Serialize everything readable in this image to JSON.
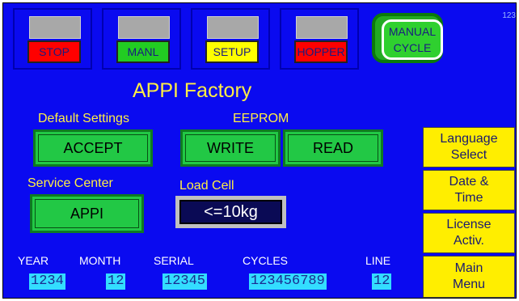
{
  "indicators": [
    {
      "label": "STOP",
      "bg": "#ff0000",
      "fg": "#1a1a80"
    },
    {
      "label": "MANL",
      "bg": "#22cc22",
      "fg": "#1a1a80"
    },
    {
      "label": "SETUP",
      "bg": "#ffff00",
      "fg": "#1a1a80"
    },
    {
      "label": "HOPPER",
      "bg": "#ff0000",
      "fg": "#1a1a80"
    }
  ],
  "manual_cycle": {
    "line1": "MANUAL",
    "line2": "CYCLE"
  },
  "corner_id": "123",
  "title": "APPI Factory",
  "default_settings": {
    "label": "Default Settings",
    "button": "ACCEPT"
  },
  "eeprom": {
    "label": "EEPROM",
    "write": "WRITE",
    "read": "READ"
  },
  "service_center": {
    "label": "Service Center",
    "button": "APPI"
  },
  "load_cell": {
    "label": "Load Cell",
    "value": "<=10kg"
  },
  "side_menu": [
    {
      "line1": "Language",
      "line2": "Select"
    },
    {
      "line1": "Date &",
      "line2": "Time"
    },
    {
      "line1": "License",
      "line2": "Activ."
    },
    {
      "line1": "Main",
      "line2": "Menu"
    }
  ],
  "info": {
    "year": {
      "label": "YEAR",
      "value": "1234"
    },
    "month": {
      "label": "MONTH",
      "value": "12"
    },
    "serial": {
      "label": "SERIAL",
      "value": "12345"
    },
    "cycles": {
      "label": "CYCLES",
      "value": "123456789"
    },
    "line": {
      "label": "LINE",
      "value": "12"
    }
  },
  "colors": {
    "background": "#0a0af0",
    "label_yellow": "#ffee44",
    "button_green": "#22c845",
    "menu_yellow": "#ffee00",
    "value_cyan": "#33ddff"
  }
}
